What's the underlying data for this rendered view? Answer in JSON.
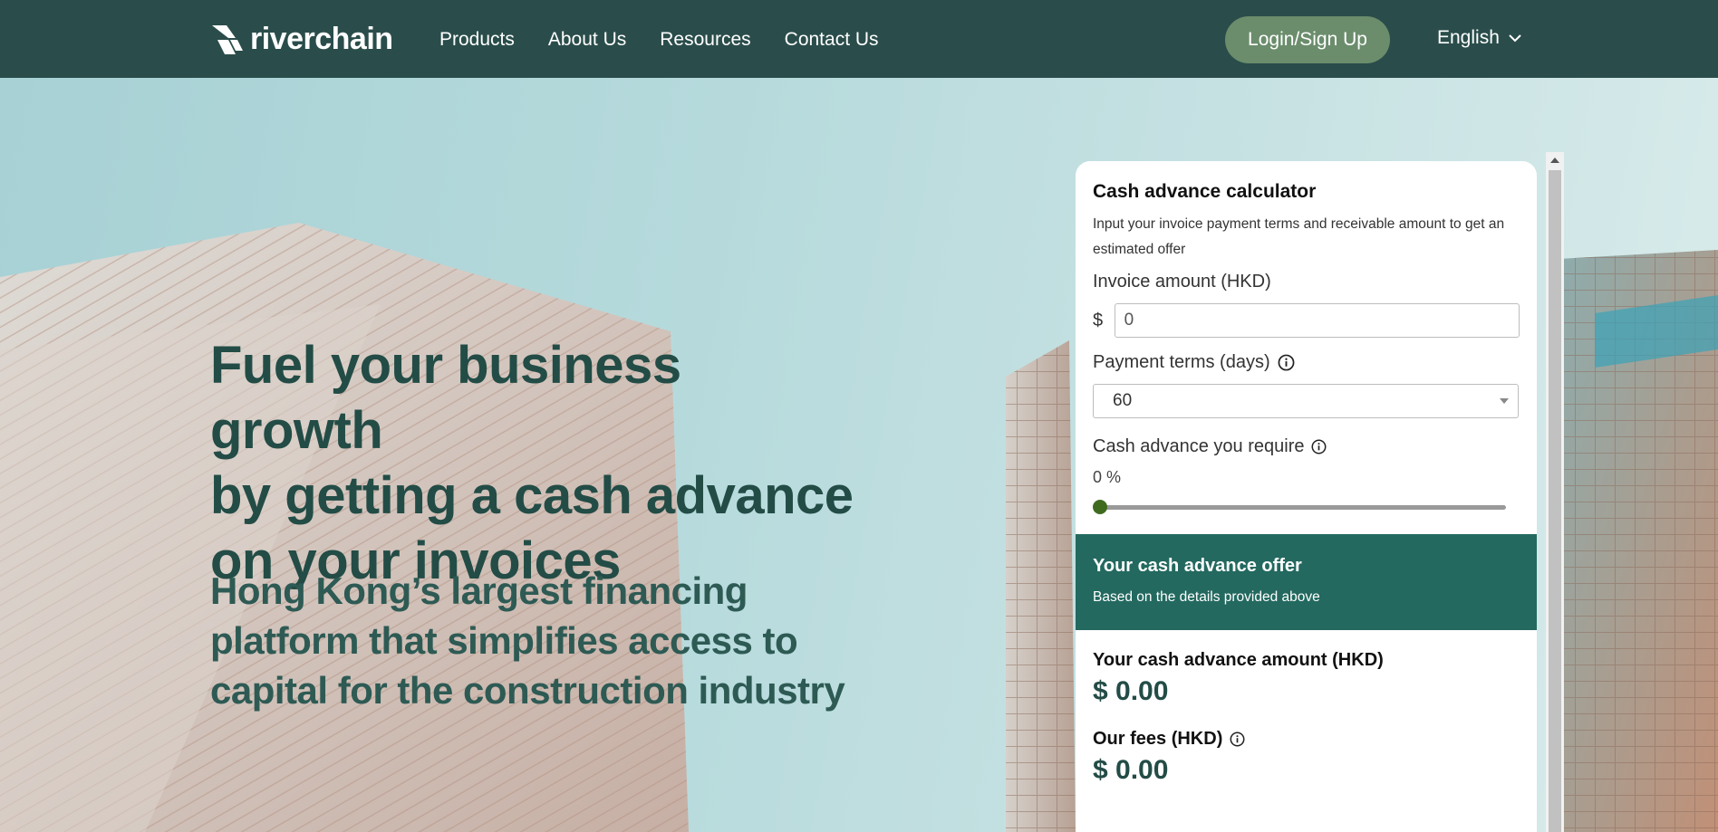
{
  "header": {
    "brand": "riverchain",
    "nav": [
      "Products",
      "About Us",
      "Resources",
      "Contact Us"
    ],
    "login_label": "Login/Sign Up",
    "language": "English"
  },
  "hero": {
    "title_lines": [
      "Fuel your business growth",
      "by getting a cash advance",
      "on your invoices"
    ],
    "subtitle_lines": [
      "Hong Kong’s largest financing",
      "platform that simplifies access to",
      "capital for the construction industry"
    ]
  },
  "calculator": {
    "title": "Cash advance calculator",
    "description": "Input your invoice payment terms and receivable amount to get an estimated offer",
    "invoice_label": "Invoice amount (HKD)",
    "currency_symbol": "$",
    "invoice_value": "0",
    "payment_terms_label": "Payment terms (days)",
    "payment_terms_value": "60",
    "advance_label": "Cash advance you require",
    "advance_percent": "0 %",
    "advance_fraction": 0,
    "offer_title": "Your cash advance offer",
    "offer_subtitle": "Based on the details provided above",
    "amount_label": "Your cash advance amount (HKD)",
    "amount_value": "$ 0.00",
    "fees_label": "Our fees (HKD)",
    "fees_value": "$ 0.00"
  },
  "colors": {
    "header_bg": "#2a4d4b",
    "login_button": "#6b8d6c",
    "offer_bg": "#23695f",
    "hero_text": "#234c46",
    "slider_thumb": "#3f6b1f"
  },
  "icons": [
    "riverchain-logo-icon",
    "chevron-down-icon",
    "info-icon",
    "dropdown-arrow-icon"
  ]
}
